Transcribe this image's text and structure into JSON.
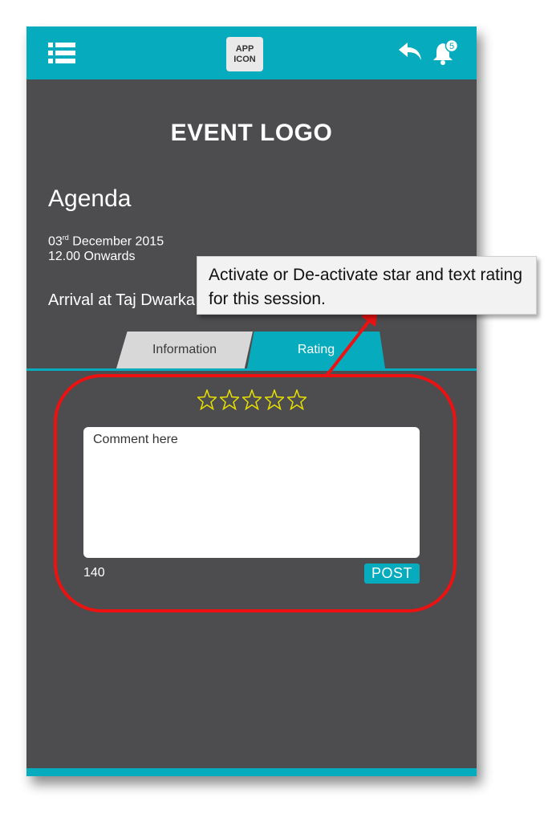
{
  "header": {
    "app_icon_label": "APP\nICON",
    "notification_count": "5",
    "icons": [
      "menu-icon",
      "back-icon",
      "bell-icon"
    ]
  },
  "event": {
    "logo_text": "EVENT LOGO",
    "section_title": "Agenda",
    "date_day": "03",
    "date_suffix": "rd",
    "date_rest": " December 2015",
    "time": "12.00 Onwards",
    "session_title": "Arrival at Taj Dwarka"
  },
  "tabs": [
    {
      "label": "Information",
      "active": false
    },
    {
      "label": "Rating",
      "active": true
    }
  ],
  "rating": {
    "stars_total": 5,
    "stars_selected": 0,
    "comment_placeholder": "Comment here",
    "char_count": "140",
    "post_label": "POST"
  },
  "annotation": {
    "callout_text": "Activate or De-activate star and text rating for this session."
  },
  "colors": {
    "accent": "#06acbd",
    "background": "#4d4d4f",
    "annotation": "#ee1111",
    "star": "#e8e000"
  }
}
